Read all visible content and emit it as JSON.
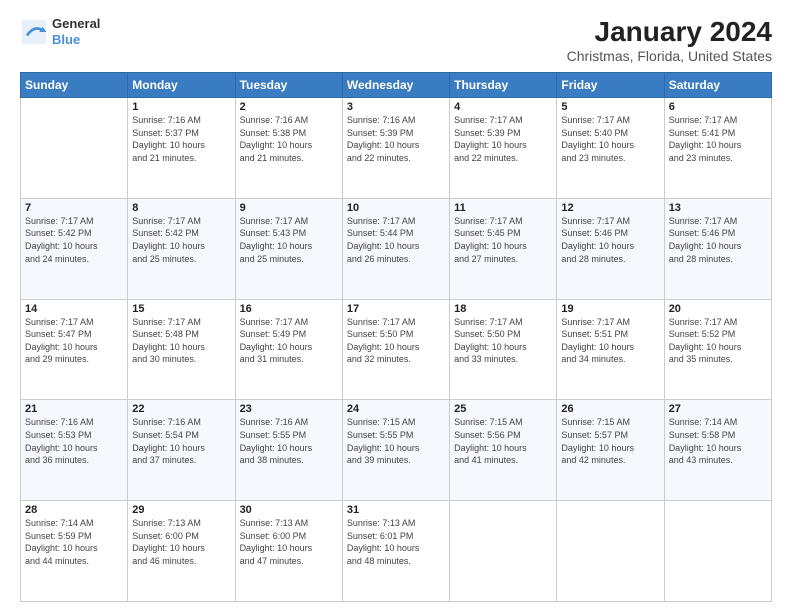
{
  "logo": {
    "line1": "General",
    "line2": "Blue"
  },
  "title": "January 2024",
  "subtitle": "Christmas, Florida, United States",
  "days_header": [
    "Sunday",
    "Monday",
    "Tuesday",
    "Wednesday",
    "Thursday",
    "Friday",
    "Saturday"
  ],
  "weeks": [
    [
      {
        "day": "",
        "info": ""
      },
      {
        "day": "1",
        "info": "Sunrise: 7:16 AM\nSunset: 5:37 PM\nDaylight: 10 hours\nand 21 minutes."
      },
      {
        "day": "2",
        "info": "Sunrise: 7:16 AM\nSunset: 5:38 PM\nDaylight: 10 hours\nand 21 minutes."
      },
      {
        "day": "3",
        "info": "Sunrise: 7:16 AM\nSunset: 5:39 PM\nDaylight: 10 hours\nand 22 minutes."
      },
      {
        "day": "4",
        "info": "Sunrise: 7:17 AM\nSunset: 5:39 PM\nDaylight: 10 hours\nand 22 minutes."
      },
      {
        "day": "5",
        "info": "Sunrise: 7:17 AM\nSunset: 5:40 PM\nDaylight: 10 hours\nand 23 minutes."
      },
      {
        "day": "6",
        "info": "Sunrise: 7:17 AM\nSunset: 5:41 PM\nDaylight: 10 hours\nand 23 minutes."
      }
    ],
    [
      {
        "day": "7",
        "info": "Sunrise: 7:17 AM\nSunset: 5:42 PM\nDaylight: 10 hours\nand 24 minutes."
      },
      {
        "day": "8",
        "info": "Sunrise: 7:17 AM\nSunset: 5:42 PM\nDaylight: 10 hours\nand 25 minutes."
      },
      {
        "day": "9",
        "info": "Sunrise: 7:17 AM\nSunset: 5:43 PM\nDaylight: 10 hours\nand 25 minutes."
      },
      {
        "day": "10",
        "info": "Sunrise: 7:17 AM\nSunset: 5:44 PM\nDaylight: 10 hours\nand 26 minutes."
      },
      {
        "day": "11",
        "info": "Sunrise: 7:17 AM\nSunset: 5:45 PM\nDaylight: 10 hours\nand 27 minutes."
      },
      {
        "day": "12",
        "info": "Sunrise: 7:17 AM\nSunset: 5:46 PM\nDaylight: 10 hours\nand 28 minutes."
      },
      {
        "day": "13",
        "info": "Sunrise: 7:17 AM\nSunset: 5:46 PM\nDaylight: 10 hours\nand 28 minutes."
      }
    ],
    [
      {
        "day": "14",
        "info": "Sunrise: 7:17 AM\nSunset: 5:47 PM\nDaylight: 10 hours\nand 29 minutes."
      },
      {
        "day": "15",
        "info": "Sunrise: 7:17 AM\nSunset: 5:48 PM\nDaylight: 10 hours\nand 30 minutes."
      },
      {
        "day": "16",
        "info": "Sunrise: 7:17 AM\nSunset: 5:49 PM\nDaylight: 10 hours\nand 31 minutes."
      },
      {
        "day": "17",
        "info": "Sunrise: 7:17 AM\nSunset: 5:50 PM\nDaylight: 10 hours\nand 32 minutes."
      },
      {
        "day": "18",
        "info": "Sunrise: 7:17 AM\nSunset: 5:50 PM\nDaylight: 10 hours\nand 33 minutes."
      },
      {
        "day": "19",
        "info": "Sunrise: 7:17 AM\nSunset: 5:51 PM\nDaylight: 10 hours\nand 34 minutes."
      },
      {
        "day": "20",
        "info": "Sunrise: 7:17 AM\nSunset: 5:52 PM\nDaylight: 10 hours\nand 35 minutes."
      }
    ],
    [
      {
        "day": "21",
        "info": "Sunrise: 7:16 AM\nSunset: 5:53 PM\nDaylight: 10 hours\nand 36 minutes."
      },
      {
        "day": "22",
        "info": "Sunrise: 7:16 AM\nSunset: 5:54 PM\nDaylight: 10 hours\nand 37 minutes."
      },
      {
        "day": "23",
        "info": "Sunrise: 7:16 AM\nSunset: 5:55 PM\nDaylight: 10 hours\nand 38 minutes."
      },
      {
        "day": "24",
        "info": "Sunrise: 7:15 AM\nSunset: 5:55 PM\nDaylight: 10 hours\nand 39 minutes."
      },
      {
        "day": "25",
        "info": "Sunrise: 7:15 AM\nSunset: 5:56 PM\nDaylight: 10 hours\nand 41 minutes."
      },
      {
        "day": "26",
        "info": "Sunrise: 7:15 AM\nSunset: 5:57 PM\nDaylight: 10 hours\nand 42 minutes."
      },
      {
        "day": "27",
        "info": "Sunrise: 7:14 AM\nSunset: 5:58 PM\nDaylight: 10 hours\nand 43 minutes."
      }
    ],
    [
      {
        "day": "28",
        "info": "Sunrise: 7:14 AM\nSunset: 5:59 PM\nDaylight: 10 hours\nand 44 minutes."
      },
      {
        "day": "29",
        "info": "Sunrise: 7:13 AM\nSunset: 6:00 PM\nDaylight: 10 hours\nand 46 minutes."
      },
      {
        "day": "30",
        "info": "Sunrise: 7:13 AM\nSunset: 6:00 PM\nDaylight: 10 hours\nand 47 minutes."
      },
      {
        "day": "31",
        "info": "Sunrise: 7:13 AM\nSunset: 6:01 PM\nDaylight: 10 hours\nand 48 minutes."
      },
      {
        "day": "",
        "info": ""
      },
      {
        "day": "",
        "info": ""
      },
      {
        "day": "",
        "info": ""
      }
    ]
  ]
}
